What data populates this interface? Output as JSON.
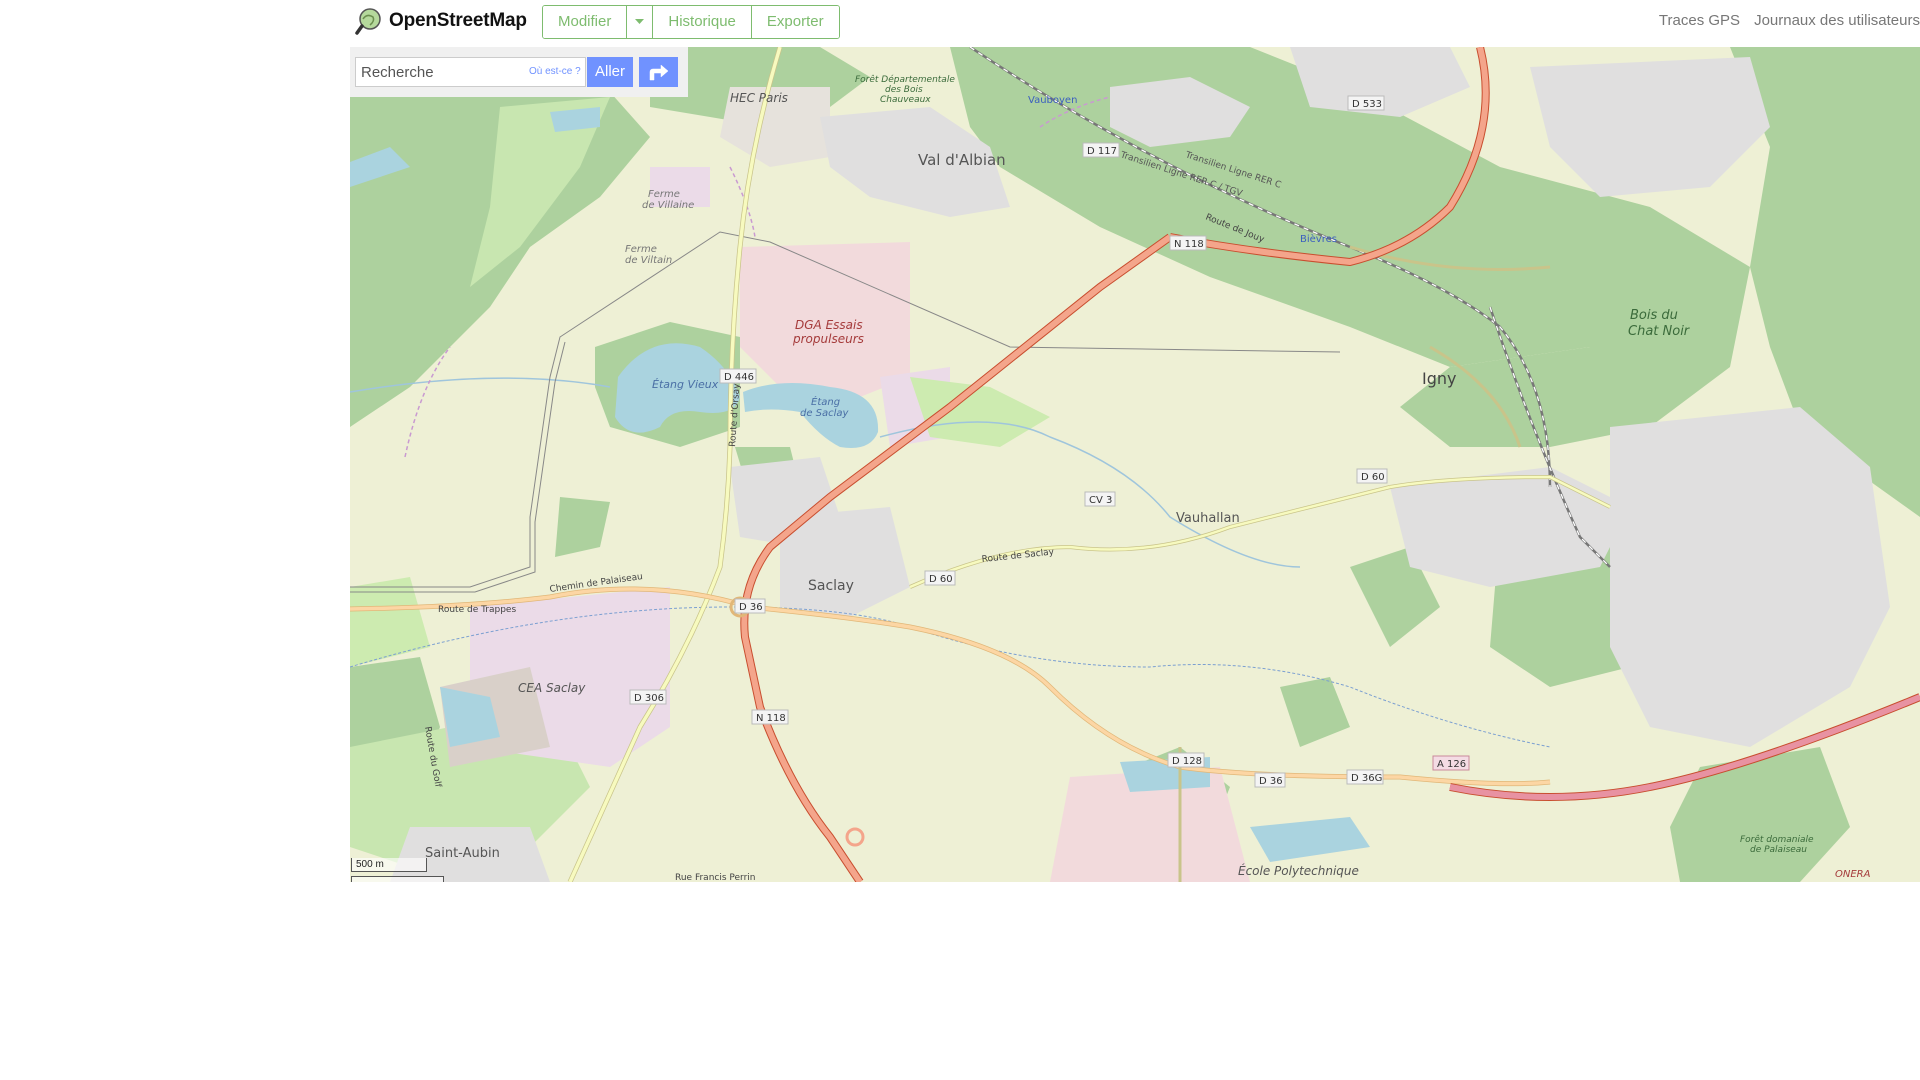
{
  "header": {
    "brand": "OpenStreetMap",
    "edit_group": [
      {
        "label": "Modifier"
      },
      {
        "label": "Historique"
      },
      {
        "label": "Exporter"
      }
    ],
    "secondary_nav": [
      {
        "label": "Traces GPS"
      },
      {
        "label": "Journaux des utilisateurs"
      }
    ]
  },
  "search": {
    "placeholder": "Recherche",
    "where_label": "Où est-ce ?",
    "go_label": "Aller",
    "directions_icon": "directions-icon"
  },
  "scale": {
    "metric_label": "500 m"
  },
  "colors": {
    "brand_green": "#7ebc6f",
    "accent_blue": "#7092ff",
    "map_bg": "#eef0d5",
    "forest": "#add19e",
    "water": "#aad3df",
    "trunk_road": "#e892a2",
    "secondary_road": "#f7fabf"
  },
  "map": {
    "places": [
      {
        "name": "HEC Paris"
      },
      {
        "name": "Val d'Albian"
      },
      {
        "name": "DGA Essais propulseurs"
      },
      {
        "name": "Étang Vieux"
      },
      {
        "name": "Étang de Saclay"
      },
      {
        "name": "Saclay"
      },
      {
        "name": "CEA Saclay"
      },
      {
        "name": "Vauhallan"
      },
      {
        "name": "Igny"
      },
      {
        "name": "Bois du Chat Noir"
      },
      {
        "name": "Vauboyen"
      },
      {
        "name": "Bièvres"
      },
      {
        "name": "Saint-Aubin"
      },
      {
        "name": "École Polytechnique"
      },
      {
        "name": "Ferme de Viltain"
      },
      {
        "name": "Ferme de Villaine"
      },
      {
        "name": "Forêt Départementale des Bois Chauveaux"
      },
      {
        "name": "Forêt domaniale de Palaiseau"
      },
      {
        "name": "ONERA"
      }
    ],
    "road_shields": [
      {
        "ref": "N 118"
      },
      {
        "ref": "N 118"
      },
      {
        "ref": "D 446"
      },
      {
        "ref": "D 36"
      },
      {
        "ref": "D 36"
      },
      {
        "ref": "D 36G"
      },
      {
        "ref": "D 60"
      },
      {
        "ref": "D 60"
      },
      {
        "ref": "D 306"
      },
      {
        "ref": "D 128"
      },
      {
        "ref": "D 117"
      },
      {
        "ref": "D 533"
      },
      {
        "ref": "CV 3"
      },
      {
        "ref": "A 126"
      }
    ],
    "road_names": [
      {
        "name": "Route de Trappes"
      },
      {
        "name": "Chemin de Palaiseau"
      },
      {
        "name": "Route de Saclay"
      },
      {
        "name": "Route d'Orsay"
      },
      {
        "name": "Route de Jouy"
      },
      {
        "name": "Route du Golf"
      },
      {
        "name": "Rue Francis Perrin"
      },
      {
        "name": "Transilien Ligne RER C"
      },
      {
        "name": "Transilien Ligne RER C / TGV"
      }
    ]
  }
}
